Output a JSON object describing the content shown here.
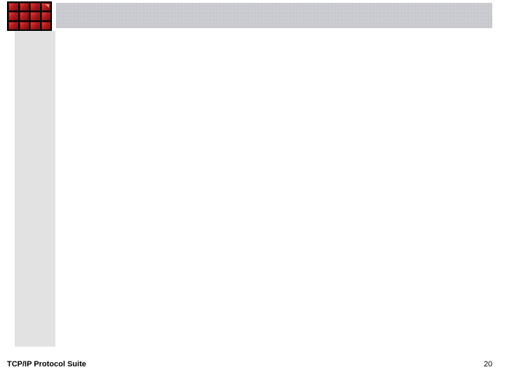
{
  "footer": {
    "title": "TCP/IP Protocol Suite",
    "page_number": "20"
  },
  "logo": {
    "rows": 3,
    "cols": 4,
    "color": "#b01818"
  }
}
